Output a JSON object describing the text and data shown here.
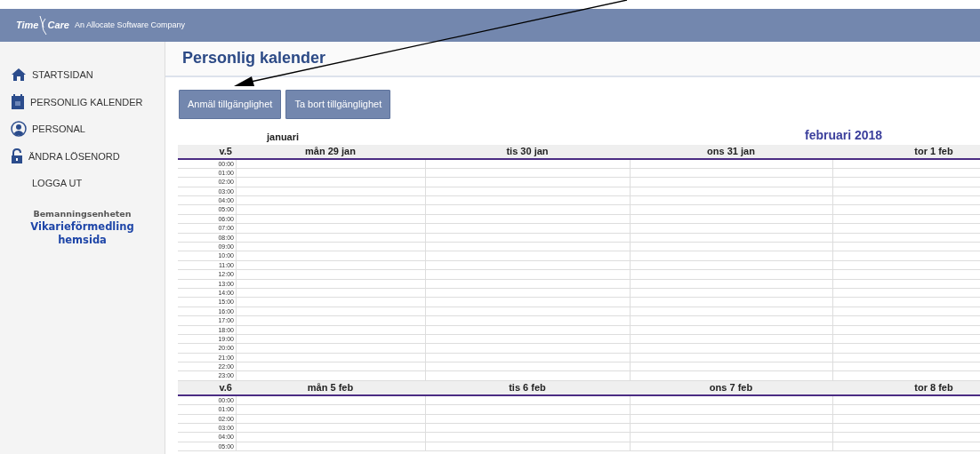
{
  "header": {
    "logo_left": "Time",
    "logo_right": "Care",
    "tagline": "An Allocate Software Company"
  },
  "sidebar": {
    "items": [
      {
        "label": "STARTSIDAN",
        "kind": "home"
      },
      {
        "label": "PERSONLIG KALENDER",
        "kind": "calendar"
      },
      {
        "label": "PERSONAL",
        "kind": "person"
      },
      {
        "label": "ÄNDRA LÖSENORD",
        "kind": "lock"
      },
      {
        "label": "LOGGA UT",
        "kind": "plain"
      }
    ],
    "unit_label": "Bemanningsenheten",
    "unit_link": "Vikarieförmedling hemsida"
  },
  "page_title": "Personlig kalender",
  "buttons": [
    "Anmäl tillgänglighet",
    "Ta bort tillgänglighet"
  ],
  "weeks": [
    {
      "label": "v.5",
      "days": [
        {
          "label": "mån 29 jan",
          "month": "januari",
          "month_start": false
        },
        {
          "label": "tis 30 jan"
        },
        {
          "label": "ons 31 jan"
        },
        {
          "label": "tor 1 feb",
          "month": "februari 2018",
          "month_start": true
        }
      ],
      "times": [
        "00:00",
        "01:00",
        "02:00",
        "03:00",
        "04:00",
        "05:00",
        "06:00",
        "07:00",
        "08:00",
        "09:00",
        "10:00",
        "11:00",
        "12:00",
        "13:00",
        "14:00",
        "15:00",
        "16:00",
        "17:00",
        "18:00",
        "19:00",
        "20:00",
        "21:00",
        "22:00",
        "23:00"
      ]
    },
    {
      "label": "v.6",
      "days": [
        {
          "label": "mån 5 feb"
        },
        {
          "label": "tis 6 feb"
        },
        {
          "label": "ons 7 feb"
        },
        {
          "label": "tor 8 feb"
        }
      ],
      "times": [
        "00:00",
        "01:00",
        "02:00",
        "03:00",
        "04:00",
        "05:00"
      ]
    }
  ]
}
